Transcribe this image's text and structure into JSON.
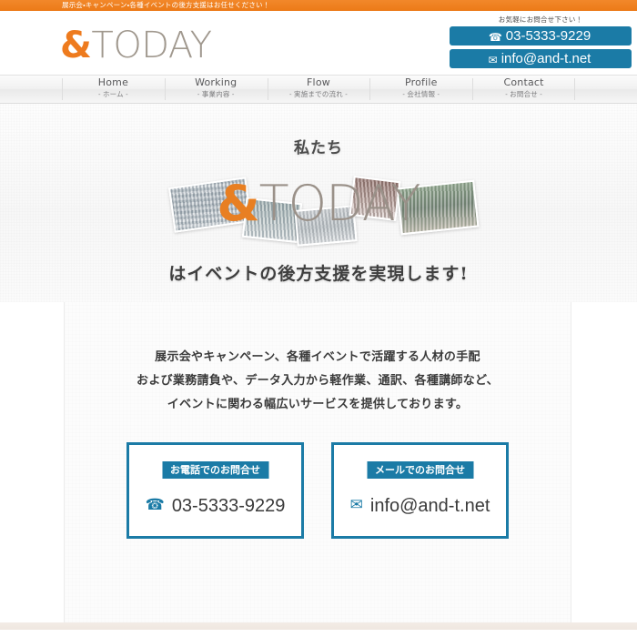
{
  "top_banner": {
    "text": "展示会・キャンペーン・各種イベントの後方支援はお任せください！",
    "background": "#ef7f20"
  },
  "header": {
    "logo": {
      "amp": "&",
      "word": "TODAY",
      "amp_color": "#ee7b1e",
      "word_color": "#a0988e"
    },
    "contact": {
      "lead": "お気軽にお問合せ下さい！",
      "phone": {
        "icon": "telephone-icon",
        "glyph": "☎",
        "label": "03-5333-9229"
      },
      "email": {
        "icon": "envelope-icon",
        "glyph": "✉",
        "label": "info@and-t.net"
      },
      "accent_color": "#1b7ba6"
    }
  },
  "nav": {
    "items": [
      {
        "en": "Home",
        "jp": "- ホーム -"
      },
      {
        "en": "Working",
        "jp": "- 事業内容 -"
      },
      {
        "en": "Flow",
        "jp": "- 実施までの流れ -"
      },
      {
        "en": "Profile",
        "jp": "- 会社情報 -"
      },
      {
        "en": "Contact",
        "jp": "- お問合せ -"
      }
    ]
  },
  "hero": {
    "line1": "私たち",
    "logo": {
      "amp": "&",
      "word": "TODAY"
    },
    "line2": "はイベントの後方支援を実現します!",
    "photos": [
      "crowd-photo-1",
      "crowd-photo-2",
      "crowd-photo-3",
      "crowd-photo-4",
      "festival-stage-photo"
    ]
  },
  "main": {
    "intro": [
      "展示会やキャンペーン、各種イベントで活躍する人材の手配",
      "および業務請負や、データ入力から軽作業、通訳、各種講師など、",
      "イベントに関わる幅広いサービスを提供しております。"
    ],
    "contact_boxes": [
      {
        "title": "お電話でのお問合せ",
        "icon": "telephone-icon",
        "glyph": "☎",
        "value": "03-5333-9229"
      },
      {
        "title": "メールでのお問合せ",
        "icon": "envelope-icon",
        "glyph": "✉",
        "value": "info@and-t.net"
      }
    ],
    "accent_color": "#1b7ba6"
  }
}
